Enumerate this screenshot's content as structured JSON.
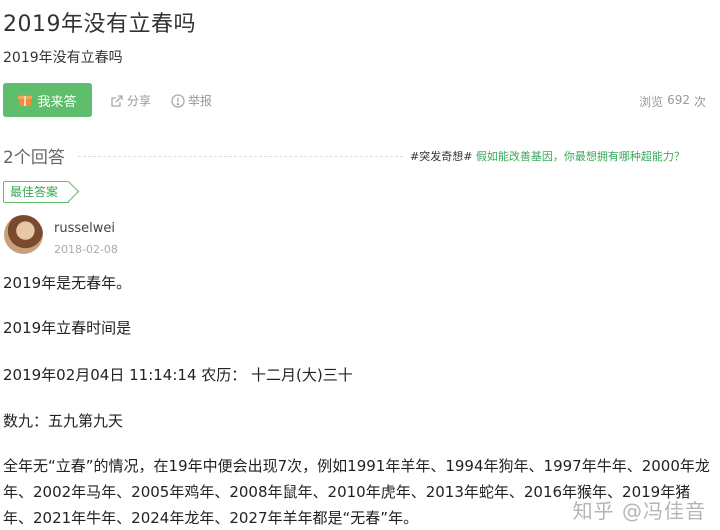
{
  "question": {
    "title": "2019年没有立春吗",
    "description": "2019年没有立春吗"
  },
  "actions": {
    "answer_label": "我来答",
    "share_label": "分享",
    "report_label": "举报",
    "views_label": "浏览",
    "views_count": "692",
    "views_unit": "次"
  },
  "answers_header": {
    "count_text": "2个回答",
    "promo_tag": "#突发奇想#",
    "promo_text": "假如能改善基因，你最想拥有哪种超能力？"
  },
  "best_answer": {
    "badge": "最佳答案",
    "user": "russelwei",
    "date": "2018-02-08",
    "paragraphs": [
      "2019年是无春年。",
      "2019年立春时间是",
      "2019年02月04日 11:14:14 农历： 十二月(大)三十",
      "数九：五九第九天",
      "全年无“立春”的情况，在19年中便会出现7次，例如1991年羊年、1994年狗年、1997年牛年、2000年龙年、2002年马年、2005年鸡年、2008年鼠年、2010年虎年、2013年蛇年、2016年猴年、2019年猪年、2021年牛年、2024年龙年、2027年羊年都是“无春”年。"
    ]
  },
  "watermark": "知乎 @冯佳音",
  "colors": {
    "accent_green": "#5fbe6e",
    "link_green": "#3aa75a",
    "muted_gray": "#999999"
  },
  "icons": [
    "gift-icon",
    "share-icon",
    "report-icon"
  ]
}
